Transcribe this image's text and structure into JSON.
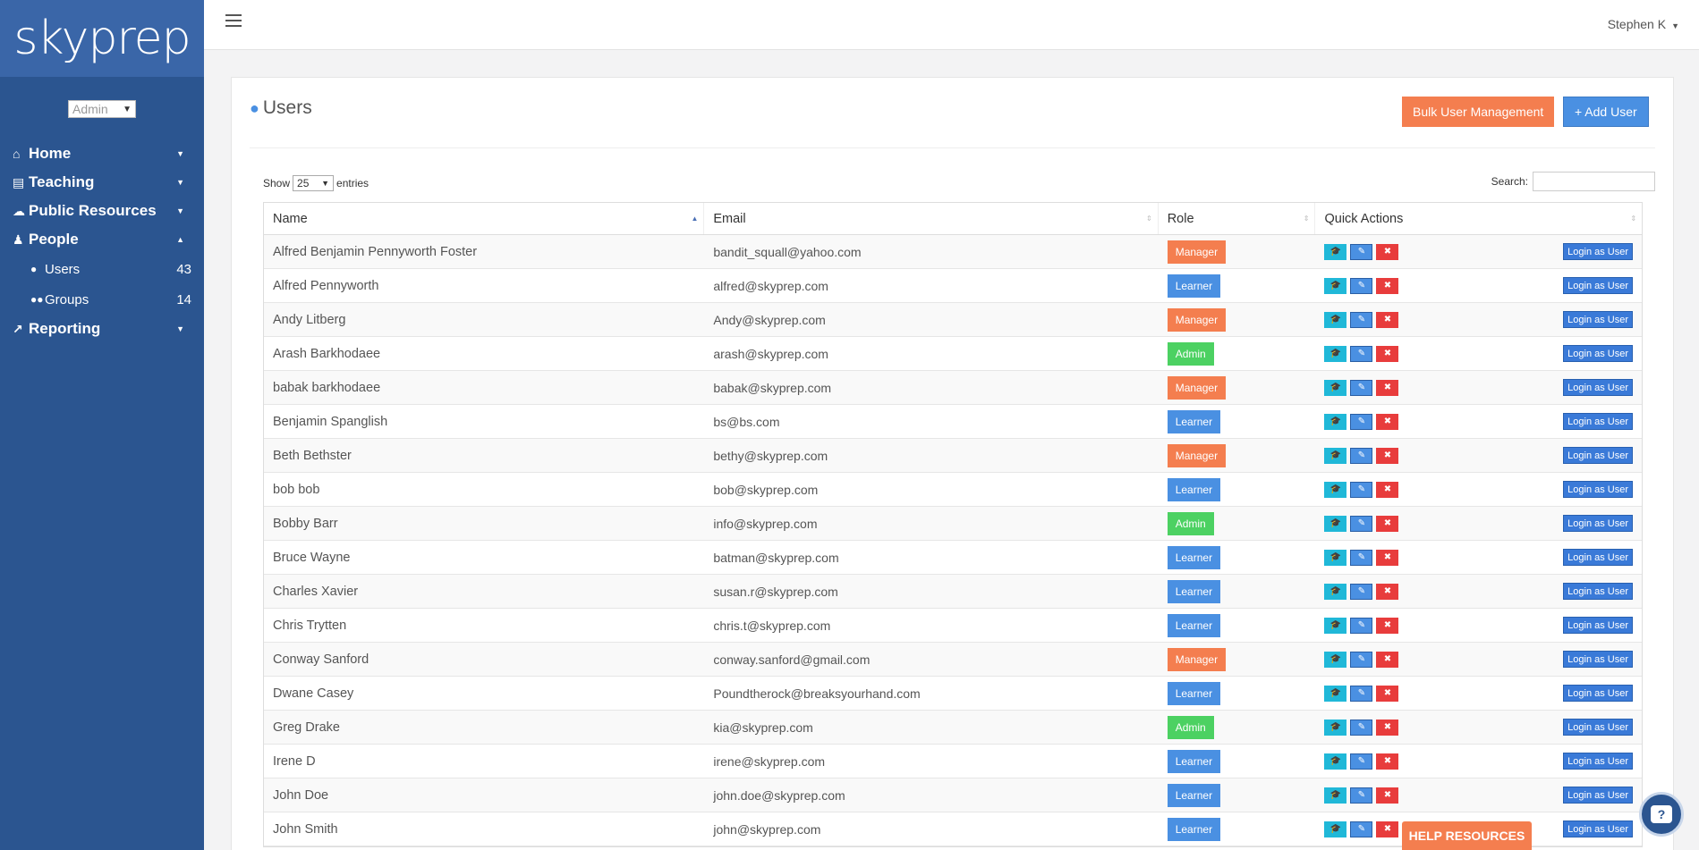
{
  "brand": {
    "logo": "skyprep"
  },
  "sidebar": {
    "role_select": "Admin",
    "nav": [
      {
        "label": "Home",
        "icon": "home-icon",
        "expanded": false
      },
      {
        "label": "Teaching",
        "icon": "book-icon",
        "expanded": false
      },
      {
        "label": "Public Resources",
        "icon": "cloud-icon",
        "expanded": false
      },
      {
        "label": "People",
        "icon": "person-icon",
        "expanded": true
      },
      {
        "label": "Reporting",
        "icon": "line-chart-icon",
        "expanded": false
      }
    ],
    "people_sub": [
      {
        "label": "Users",
        "count": "43",
        "icon": "user-icon"
      },
      {
        "label": "Groups",
        "count": "14",
        "icon": "group-icon"
      }
    ]
  },
  "topbar": {
    "user_name": "Stephen K"
  },
  "page": {
    "title": "Users",
    "bulk_button": "Bulk User Management",
    "add_button": "Add User",
    "show_label": "Show",
    "entries_value": "25",
    "entries_label": "entries",
    "search_label": "Search:"
  },
  "table": {
    "headers": {
      "name": "Name",
      "email": "Email",
      "role": "Role",
      "quick_actions": "Quick Actions"
    },
    "login_label": "Login as User",
    "rows": [
      {
        "name": "Alfred Benjamin Pennyworth Foster",
        "email": "bandit_squall@yahoo.com",
        "role": "Manager"
      },
      {
        "name": "Alfred Pennyworth",
        "email": "alfred@skyprep.com",
        "role": "Learner"
      },
      {
        "name": "Andy Litberg",
        "email": "Andy@skyprep.com",
        "role": "Manager"
      },
      {
        "name": "Arash Barkhodaee",
        "email": "arash@skyprep.com",
        "role": "Admin"
      },
      {
        "name": "babak barkhodaee",
        "email": "babak@skyprep.com",
        "role": "Manager"
      },
      {
        "name": "Benjamin Spanglish",
        "email": "bs@bs.com",
        "role": "Learner"
      },
      {
        "name": "Beth Bethster",
        "email": "bethy@skyprep.com",
        "role": "Manager"
      },
      {
        "name": "bob bob",
        "email": "bob@skyprep.com",
        "role": "Learner"
      },
      {
        "name": "Bobby Barr",
        "email": "info@skyprep.com",
        "role": "Admin"
      },
      {
        "name": "Bruce Wayne",
        "email": "batman@skyprep.com",
        "role": "Learner"
      },
      {
        "name": "Charles Xavier",
        "email": "susan.r@skyprep.com",
        "role": "Learner"
      },
      {
        "name": "Chris Trytten",
        "email": "chris.t@skyprep.com",
        "role": "Learner"
      },
      {
        "name": "Conway Sanford",
        "email": "conway.sanford@gmail.com",
        "role": "Manager"
      },
      {
        "name": "Dwane Casey",
        "email": "Poundtherock@breaksyourhand.com",
        "role": "Learner"
      },
      {
        "name": "Greg Drake",
        "email": "kia@skyprep.com",
        "role": "Admin"
      },
      {
        "name": "Irene D",
        "email": "irene@skyprep.com",
        "role": "Learner"
      },
      {
        "name": "John Doe",
        "email": "john.doe@skyprep.com",
        "role": "Learner"
      },
      {
        "name": "John Smith",
        "email": "john@skyprep.com",
        "role": "Learner"
      }
    ]
  },
  "floating": {
    "help_resources": "HELP RESOURCES",
    "help_icon": "question-icon"
  },
  "colors": {
    "sidebar": "#2b5590",
    "manager": "#f47e4f",
    "learner": "#4a90e2",
    "admin": "#4cd162"
  }
}
